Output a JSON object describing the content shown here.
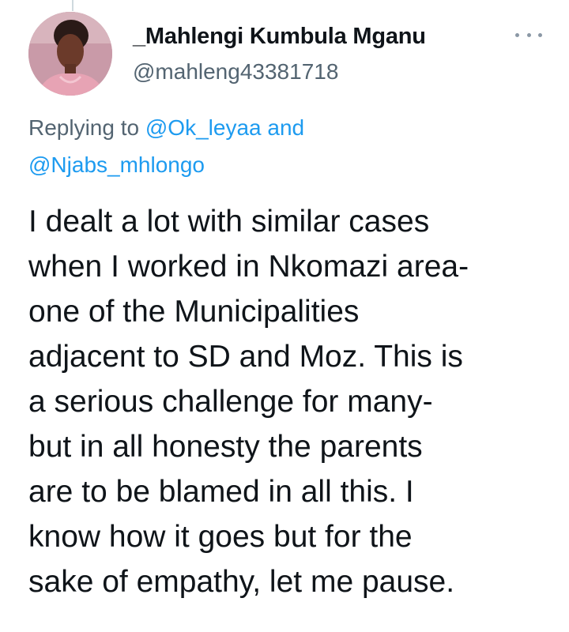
{
  "author": {
    "display_name": "_Mahlengi Kumbula Mganu",
    "handle": "@mahleng43381718",
    "avatar_icon": "profile-photo"
  },
  "more_menu": {
    "icon": "more-horizontal-icon"
  },
  "reply": {
    "prefix": "Replying to",
    "mention_1": "@Ok_leyaa",
    "joiner": "and",
    "mention_2": "@Njabs_mhlongo"
  },
  "tweet": {
    "lines": [
      "I dealt a lot with similar cases",
      "when I worked in Nkomazi area-",
      "one of the Municipalities",
      "adjacent to SD and Moz. This is",
      "a serious challenge for many-",
      "but in all honesty the parents",
      "are to be blamed in all this. I",
      "know how it goes but for the",
      "sake of empathy, let me pause."
    ]
  },
  "colors": {
    "text_primary": "#0f1419",
    "text_secondary": "#536471",
    "link": "#1d9bf0",
    "thread_line": "#cfd9de"
  }
}
